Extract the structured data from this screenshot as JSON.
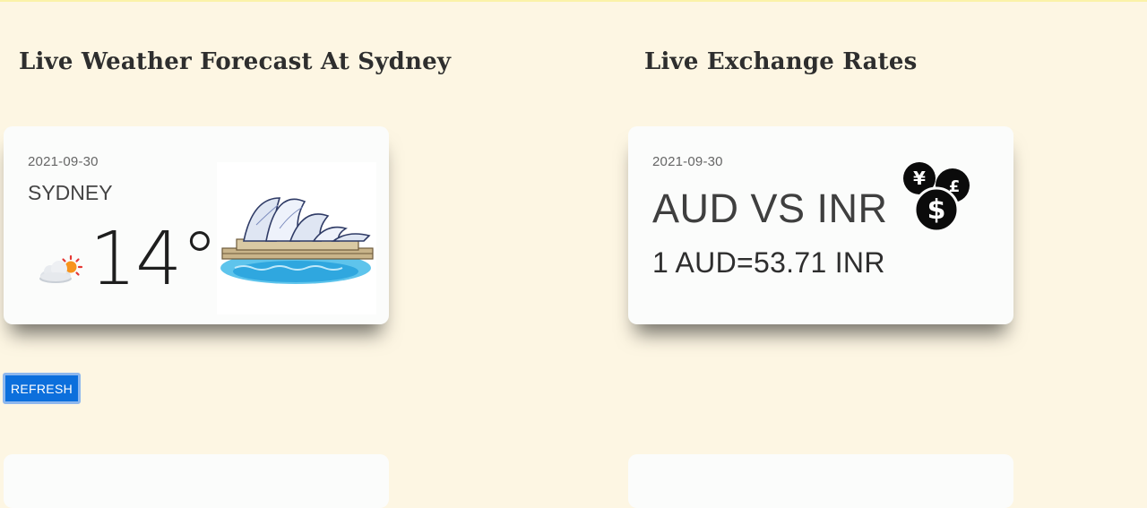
{
  "weather": {
    "heading": "Live Weather Forecast At Sydney",
    "date": "2021-09-30",
    "city": "SYDNEY",
    "temperature": "14°",
    "condition_icon": "partly-cloudy-icon",
    "image_icon": "sydney-opera-house-icon"
  },
  "rates": {
    "heading": "Live Exchange Rates",
    "date": "2021-09-30",
    "pair": "AUD VS INR",
    "rate": "1 AUD=53.71 INR",
    "icon": "currency-coins-icon"
  },
  "refresh_label": "REFRESH",
  "colors": {
    "background": "#fdf6e3",
    "card": "#fbfcfb",
    "button": "#0c6fdc"
  }
}
